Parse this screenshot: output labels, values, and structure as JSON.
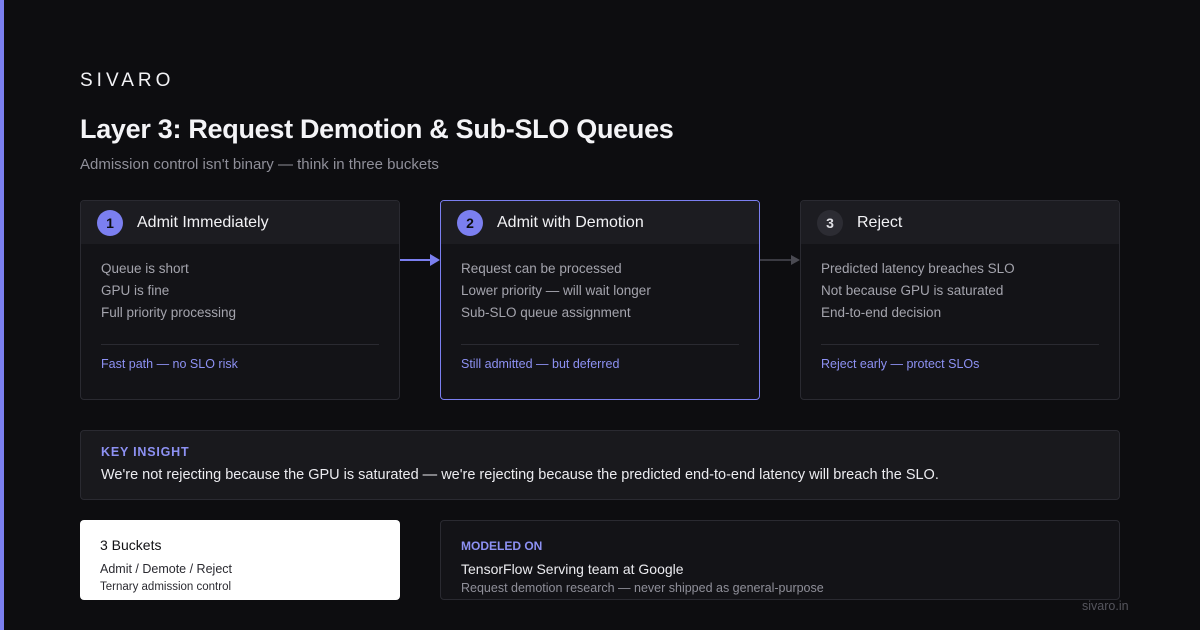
{
  "brand": "SIVARO",
  "title": "Layer 3: Request Demotion & Sub-SLO Queues",
  "subtitle": "Admission control isn't binary — think in three buckets",
  "buckets": [
    {
      "number": "1",
      "title": "Admit Immediately",
      "lines": [
        "Queue is short",
        "GPU is fine",
        "Full priority processing"
      ],
      "footer": "Fast path — no SLO risk"
    },
    {
      "number": "2",
      "title": "Admit with Demotion",
      "lines": [
        "Request can be processed",
        "Lower priority — will wait longer",
        "Sub-SLO queue assignment"
      ],
      "footer": "Still admitted — but deferred"
    },
    {
      "number": "3",
      "title": "Reject",
      "lines": [
        "Predicted latency breaches SLO",
        "Not because GPU is saturated",
        "End-to-end decision"
      ],
      "footer": "Reject early — protect SLOs"
    }
  ],
  "insight": {
    "label": "KEY INSIGHT",
    "text": "We're not rejecting because the GPU is saturated — we're rejecting because the predicted end-to-end latency will breach the SLO."
  },
  "stat": {
    "title": "3 Buckets",
    "line": "Admit / Demote / Reject",
    "sub": "Ternary admission control"
  },
  "model": {
    "label": "MODELED ON",
    "title": "TensorFlow Serving team at Google",
    "sub": "Request demotion research — never shipped as general-purpose"
  },
  "footer_url": "sivaro.in",
  "colors": {
    "accent": "#7b7ff0",
    "background": "#0d0d10",
    "card": "#131317",
    "muted_arrow": "#4a4a52"
  }
}
